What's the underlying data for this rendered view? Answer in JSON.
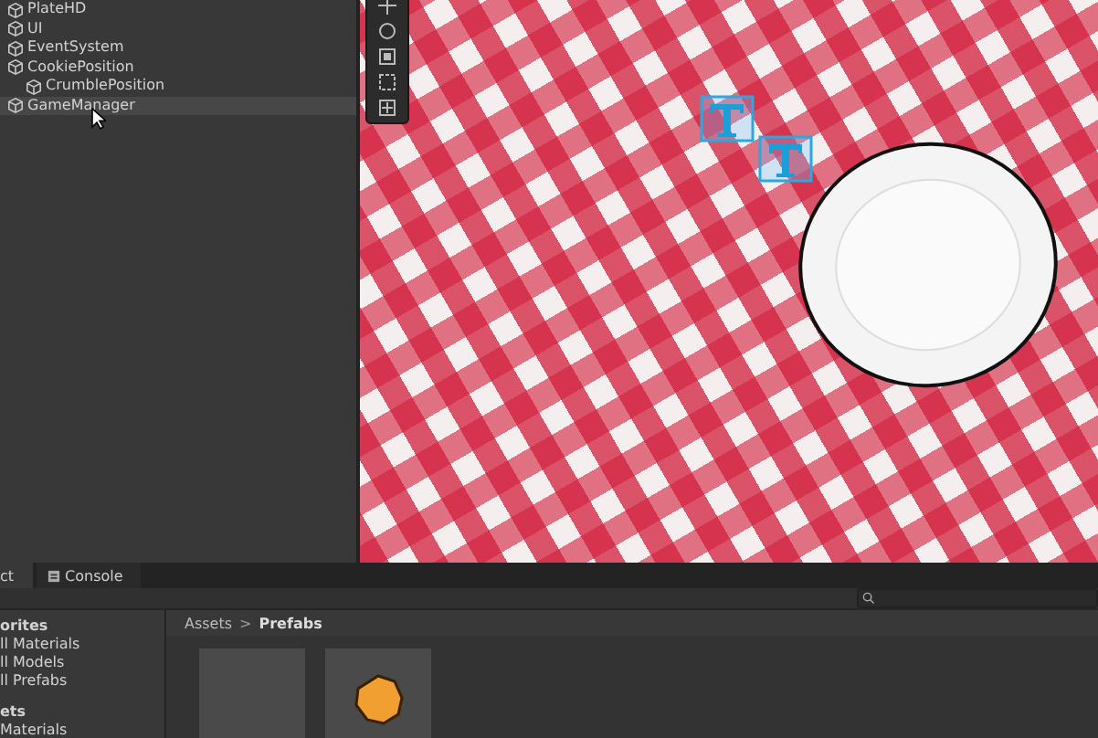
{
  "hierarchy": {
    "items": [
      {
        "label": "PlateHD",
        "selected": false
      },
      {
        "label": "UI",
        "selected": false
      },
      {
        "label": "EventSystem",
        "selected": false
      },
      {
        "label": "CookiePosition",
        "selected": false,
        "children": [
          {
            "label": "CrumblePosition",
            "selected": false
          }
        ]
      },
      {
        "label": "GameManager",
        "selected": true
      }
    ]
  },
  "bottom_panel": {
    "tabs": [
      {
        "label": "ct",
        "selected": true
      },
      {
        "label": "Console",
        "selected": false
      }
    ],
    "sidebar": {
      "sections": [
        {
          "heading": "orites",
          "items": [
            "ll Materials",
            "ll Models",
            "ll Prefabs"
          ]
        },
        {
          "heading": "ets",
          "items": [
            "Materials"
          ]
        }
      ]
    },
    "breadcrumb": {
      "items": [
        "Assets",
        "Prefabs"
      ],
      "separator": ">"
    },
    "assets": [
      {
        "kind": "empty"
      },
      {
        "kind": "cookie"
      }
    ]
  }
}
